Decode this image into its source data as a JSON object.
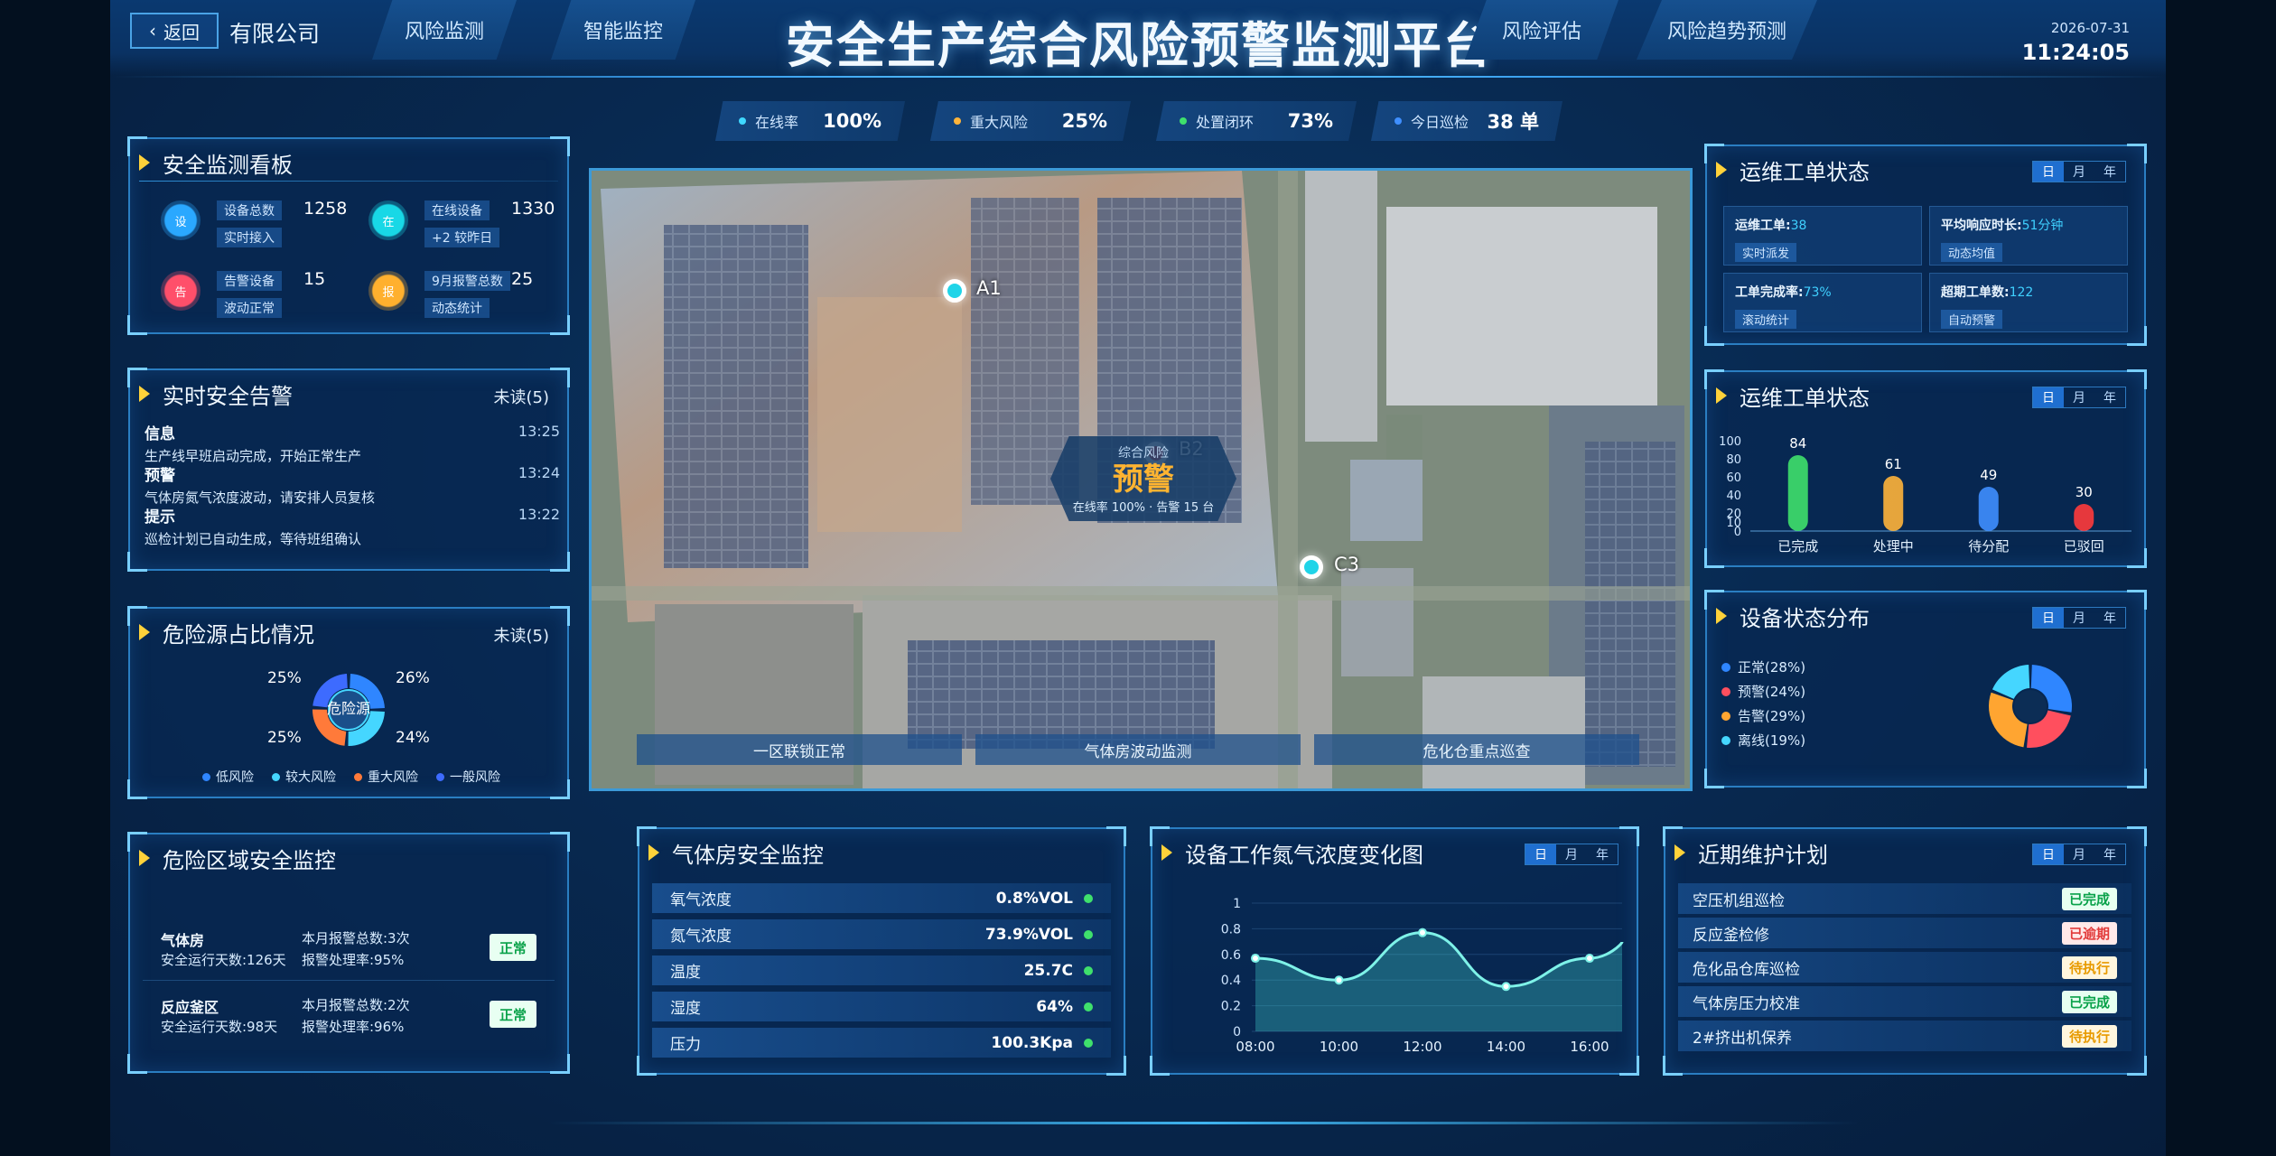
{
  "header": {
    "back": "返回",
    "company": "有限公司",
    "title": "安全生产综合风险预警监测平台",
    "tabs": [
      "风险监测",
      "智能监控",
      "风险评估",
      "风险趋势预测"
    ],
    "date": "2026-07-31",
    "time": "11:24:05"
  },
  "stats": [
    {
      "label": "在线率",
      "value": "100%",
      "color": "#3fd8ff"
    },
    {
      "label": "重大风险",
      "value": "25%",
      "color": "#ffb43a"
    },
    {
      "label": "处置闭环",
      "value": "73%",
      "color": "#3fe06c"
    },
    {
      "label": "今日巡检",
      "value": "38 单",
      "color": "#3f8fff"
    }
  ],
  "overview": {
    "title": "安全监测看板",
    "items": [
      {
        "icon": "设",
        "name": "设备总数",
        "value": "1258",
        "sub": "实时接入",
        "color": "#2aa8ff"
      },
      {
        "icon": "在",
        "name": "在线设备",
        "value": "1330",
        "sub": "+2 较昨日",
        "color": "#18d8e6"
      },
      {
        "icon": "告",
        "name": "告警设备",
        "value": "15",
        "sub": "波动正常",
        "color": "#ff4f6a"
      },
      {
        "icon": "报",
        "name": "9月报警总数",
        "value": "25",
        "sub": "动态统计",
        "color": "#ffb02e"
      }
    ]
  },
  "alarms": {
    "title": "实时安全告警",
    "unread": "未读(5)",
    "items": [
      {
        "type": "信息",
        "msg": "生产线早班启动完成，开始正常生产",
        "time": "13:25"
      },
      {
        "type": "预警",
        "msg": "气体房氮气浓度波动，请安排人员复核",
        "time": "13:24"
      },
      {
        "type": "提示",
        "msg": "巡检计划已自动生成，等待班组确认",
        "time": "13:22"
      }
    ]
  },
  "hazard": {
    "title": "危险源占比情况",
    "unread": "未读(5)",
    "center": "危险源",
    "pcts": [
      "25%",
      "26%",
      "25%",
      "24%"
    ],
    "legend": [
      {
        "label": "低风险",
        "color": "#2f86ff"
      },
      {
        "label": "较大风险",
        "color": "#45d6ff"
      },
      {
        "label": "重大风险",
        "color": "#ff7a3a"
      },
      {
        "label": "一般风险",
        "color": "#3d6bff"
      }
    ]
  },
  "danger_zone": {
    "title": "危险区域安全监控",
    "rows": [
      {
        "name": "气体房",
        "days": "安全运行天数:126天",
        "a": "本月报警总数:3次",
        "b": "报警处理率:95%",
        "status": "正常"
      },
      {
        "name": "反应釜区",
        "days": "安全运行天数:98天",
        "a": "本月报警总数:2次",
        "b": "报警处理率:96%",
        "status": "正常"
      }
    ]
  },
  "map": {
    "markers": [
      {
        "label": "A1",
        "color": "#20d4e8"
      },
      {
        "label": "B2",
        "color": "#ff3b3b"
      },
      {
        "label": "C3",
        "color": "#20d4e8"
      }
    ],
    "warn": {
      "top": "综合风险",
      "big": "预警",
      "sub": "在线率 100% · 告警 15 台"
    },
    "bands": [
      "一区联锁正常",
      "气体房波动监测",
      "危化仓重点巡查"
    ]
  },
  "gas_room": {
    "title": "气体房安全监控",
    "rows": [
      {
        "label": "氧气浓度",
        "value": "0.8%VOL"
      },
      {
        "label": "氮气浓度",
        "value": "73.9%VOL"
      },
      {
        "label": "温度",
        "value": "25.7C"
      },
      {
        "label": "湿度",
        "value": "64%"
      },
      {
        "label": "压力",
        "value": "100.3Kpa"
      }
    ]
  },
  "period": [
    "日",
    "月",
    "年"
  ],
  "work_order_1": {
    "title": "运维工单状态",
    "items": [
      {
        "k": "运维工单:",
        "v": "38",
        "s": "实时派发"
      },
      {
        "k": "平均响应时长:",
        "v": "51分钟",
        "s": "动态均值"
      },
      {
        "k": "工单完成率:",
        "v": "73%",
        "s": "滚动统计"
      },
      {
        "k": "超期工单数:",
        "v": "122",
        "s": "自动预警"
      }
    ]
  },
  "work_order_2": {
    "title": "运维工单状态"
  },
  "device_status": {
    "title": "设备状态分布",
    "legend": [
      {
        "label": "正常(28%)",
        "color": "#2f86ff"
      },
      {
        "label": "预警(24%)",
        "color": "#ff4f5e"
      },
      {
        "label": "告警(29%)",
        "color": "#ffa531"
      },
      {
        "label": "离线(19%)",
        "color": "#45d6ff"
      }
    ]
  },
  "trend": {
    "title": "设备工作氮气浓度变化图"
  },
  "maintenance": {
    "title": "近期维护计划",
    "items": [
      {
        "name": "空压机组巡检",
        "status": "已完成",
        "fg": "#0aa24a",
        "bg": "#e6fff0"
      },
      {
        "name": "反应釜检修",
        "status": "已逾期",
        "fg": "#e23b3b",
        "bg": "#ffe9e9"
      },
      {
        "name": "危化品仓库巡检",
        "status": "待执行",
        "fg": "#e89a00",
        "bg": "#fff6de"
      },
      {
        "name": "气体房压力校准",
        "status": "已完成",
        "fg": "#0aa24a",
        "bg": "#e6fff0"
      },
      {
        "name": "2#挤出机保养",
        "status": "待执行",
        "fg": "#e89a00",
        "bg": "#fff6de"
      }
    ]
  },
  "chart_data": [
    {
      "type": "bar",
      "title": "运维工单状态",
      "categories": [
        "已完成",
        "处理中",
        "待分配",
        "已驳回"
      ],
      "values": [
        84,
        61,
        49,
        30
      ],
      "ylim": [
        0,
        100
      ],
      "yticks": [
        0,
        10,
        20,
        40,
        60,
        80,
        100
      ],
      "colors": [
        "#3fe06c",
        "#ffb43a",
        "#3f8fff",
        "#ff3b3b"
      ]
    },
    {
      "type": "line",
      "title": "设备工作氮气浓度变化图",
      "x": [
        "08:00",
        "10:00",
        "12:00",
        "14:00",
        "16:00"
      ],
      "y": [
        0.57,
        0.4,
        0.77,
        0.35,
        0.57
      ],
      "ylim": [
        0,
        1
      ],
      "yticks": [
        "0",
        "0.2",
        "0.4",
        "0.6",
        "0.8",
        "1"
      ]
    },
    {
      "type": "pie",
      "title": "危险源占比情况",
      "labels": [
        "低风险",
        "较大风险",
        "重大风险",
        "一般风险"
      ],
      "values": [
        25,
        26,
        25,
        24
      ]
    },
    {
      "type": "pie",
      "title": "设备状态分布",
      "labels": [
        "正常",
        "预警",
        "告警",
        "离线"
      ],
      "values": [
        28,
        24,
        29,
        19
      ]
    }
  ]
}
